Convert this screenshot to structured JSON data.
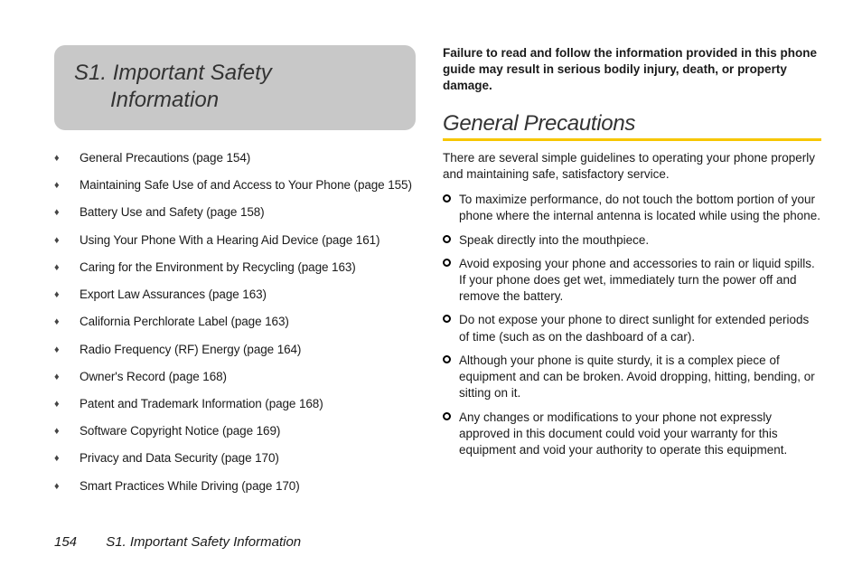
{
  "section": {
    "number": "S1.",
    "title_line1": "S1. Important Safety",
    "title_line2": "Information"
  },
  "toc": [
    "General Precautions (page 154)",
    "Maintaining Safe Use of and Access to Your Phone (page 155)",
    "Battery Use and Safety (page 158)",
    "Using Your Phone With a Hearing Aid Device (page 161)",
    "Caring for the Environment by Recycling (page 163)",
    "Export Law Assurances (page 163)",
    "California Perchlorate Label (page 163)",
    "Radio Frequency (RF) Energy (page 164)",
    "Owner's Record (page 168)",
    "Patent and Trademark Information (page 168)",
    "Software Copyright Notice (page 169)",
    "Privacy and Data Security (page 170)",
    "Smart Practices While Driving (page 170)"
  ],
  "warning": "Failure to read and follow the information provided in this phone guide may result in serious bodily injury, death, or property damage.",
  "subsection": {
    "title": "General Precautions",
    "intro": "There are several simple guidelines to operating your phone properly and maintaining safe, satisfactory service.",
    "items": [
      "To maximize performance, do not touch the bottom portion of your phone where the internal antenna is located while using the phone.",
      "Speak directly into the mouthpiece.",
      "Avoid exposing your phone and accessories to rain or liquid spills. If your phone does get wet, immediately turn the power off and remove the battery.",
      "Do not expose your phone to direct sunlight for extended periods of time (such as on the dashboard of a car).",
      "Although your phone is quite sturdy, it is a complex piece of equipment and can be broken. Avoid dropping, hitting, bending, or sitting on it.",
      "Any changes or modifications to your phone not expressly approved in this document could void your warranty for this equipment and void your authority to operate this equipment."
    ]
  },
  "footer": {
    "page_number": "154",
    "running_title": "S1. Important Safety Information"
  },
  "colors": {
    "accent": "#f7c600",
    "header_bg": "#c8c8c8"
  }
}
